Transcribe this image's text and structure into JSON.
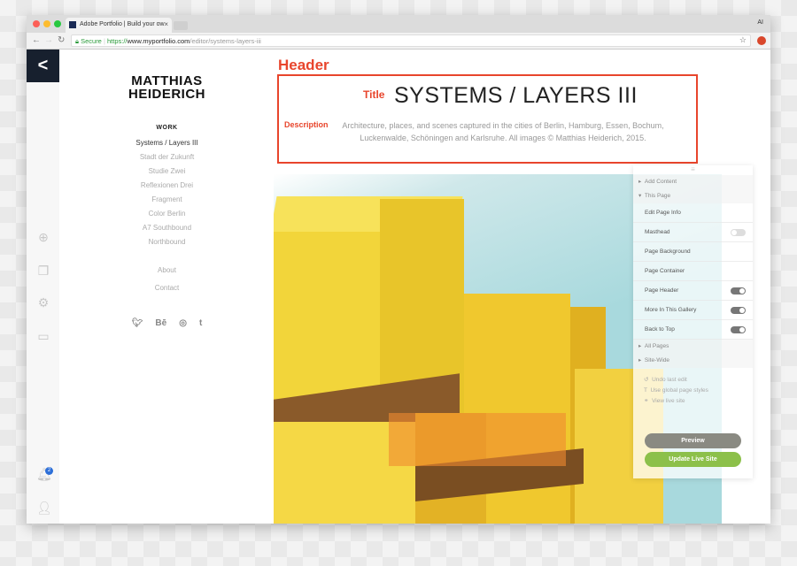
{
  "browser": {
    "tab_title": "Adobe Portfolio | Build your ow",
    "tab_close": "×",
    "profile": "AI",
    "secure": "Secure",
    "url_scheme": "https://",
    "url_domain": "www.myportfolio.com",
    "url_path": "/editor/systems-layers-iii",
    "star": "☆"
  },
  "rail": {
    "back": "<",
    "notification_count": "2",
    "icons": [
      "plus-circle-icon",
      "pages-icon",
      "gear-icon",
      "layout-icon",
      "bell-icon",
      "user-icon"
    ]
  },
  "sidebar": {
    "logo_line1": "MATTHIAS",
    "logo_line2": "HEIDERICH",
    "section": "WORK",
    "items": [
      "Systems / Layers III",
      "Stadt der Zukunft",
      "Studie Zwei",
      "Reflexionen Drei",
      "Fragment",
      "Color Berlin",
      "A7 Southbound",
      "Northbound"
    ],
    "links": [
      "About",
      "Contact"
    ],
    "social": [
      "twitter",
      "Bē",
      "instagram",
      "t"
    ]
  },
  "header": {
    "label": "Header",
    "title_label": "Title",
    "title": "SYSTEMS / LAYERS III",
    "description_label": "Description",
    "description": "Architecture, places, and scenes captured in the cities of Berlin, Hamburg, Essen, Bochum, Luckenwalde, Schöningen and Karlsruhe. All images © Matthias Heiderich, 2015.",
    "accent": "#e8452c"
  },
  "panel": {
    "add_content": "Add Content",
    "this_page": "This Page",
    "rows": [
      {
        "label": "Edit Page Info"
      },
      {
        "label": "Masthead",
        "toggle": false
      },
      {
        "label": "Page Background"
      },
      {
        "label": "Page Container"
      },
      {
        "label": "Page Header",
        "toggle": true
      },
      {
        "label": "More In This Gallery",
        "toggle": true
      },
      {
        "label": "Back to Top",
        "toggle": true
      }
    ],
    "all_pages": "All Pages",
    "site_wide": "Site-Wide",
    "undo": "Undo last edit",
    "global_styles": "Use global page styles",
    "view_live": "View live site",
    "preview": "Preview",
    "update": "Update Live Site"
  }
}
